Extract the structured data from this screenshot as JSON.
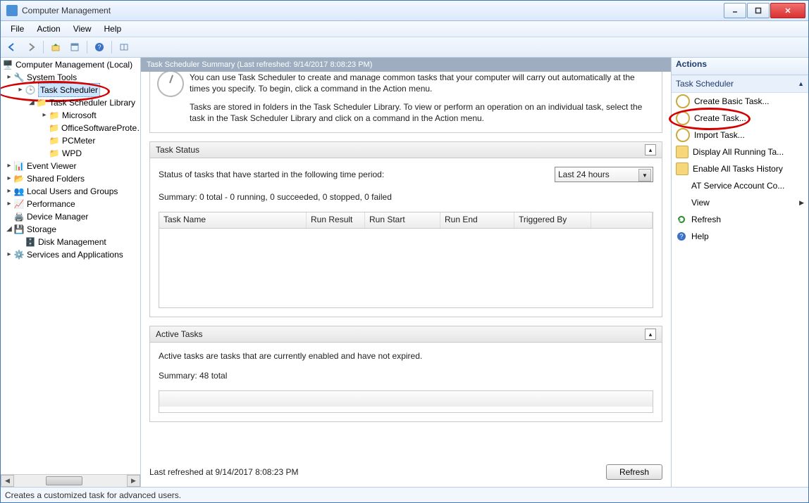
{
  "window": {
    "title": "Computer Management"
  },
  "menus": {
    "file": "File",
    "action": "Action",
    "view": "View",
    "help": "Help"
  },
  "tree": {
    "root": "Computer Management (Local)",
    "system_tools": "System Tools",
    "task_scheduler": "Task Scheduler",
    "ts_library": "Task Scheduler Library",
    "microsoft": "Microsoft",
    "office": "OfficeSoftwareProte…",
    "pcmeter": "PCMeter",
    "wpd": "WPD",
    "event_viewer": "Event Viewer",
    "shared_folders": "Shared Folders",
    "local_users": "Local Users and Groups",
    "performance": "Performance",
    "device_manager": "Device Manager",
    "storage": "Storage",
    "disk_mgmt": "Disk Management",
    "services_apps": "Services and Applications"
  },
  "summary_header": "Task Scheduler Summary (Last refreshed: 9/14/2017 8:08:23 PM)",
  "overview": {
    "p1": "You can use Task Scheduler to create and manage common tasks that your computer will carry out automatically at the times you specify. To begin, click a command in the Action menu.",
    "p2": "Tasks are stored in folders in the Task Scheduler Library. To view or perform an operation on an individual task, select the task in the Task Scheduler Library and click on a command in the Action menu."
  },
  "task_status": {
    "title": "Task Status",
    "line1": "Status of tasks that have started in the following time period:",
    "period": "Last 24 hours",
    "summary": "Summary: 0 total - 0 running, 0 succeeded, 0 stopped, 0 failed",
    "cols": {
      "name": "Task Name",
      "result": "Run Result",
      "start": "Run Start",
      "end": "Run End",
      "trigger": "Triggered By"
    }
  },
  "active_tasks": {
    "title": "Active Tasks",
    "desc": "Active tasks are tasks that are currently enabled and have not expired.",
    "summary": "Summary: 48 total"
  },
  "last_refreshed": "Last refreshed at 9/14/2017 8:08:23 PM",
  "refresh_btn": "Refresh",
  "actions": {
    "header": "Actions",
    "group": "Task Scheduler",
    "create_basic": "Create Basic Task...",
    "create_task": "Create Task...",
    "import_task": "Import Task...",
    "display_running": "Display All Running Ta...",
    "enable_hist": "Enable All Tasks History",
    "at_service": "AT Service Account Co...",
    "view": "View",
    "refresh": "Refresh",
    "help": "Help"
  },
  "statusbar": "Creates a customized task for advanced users."
}
